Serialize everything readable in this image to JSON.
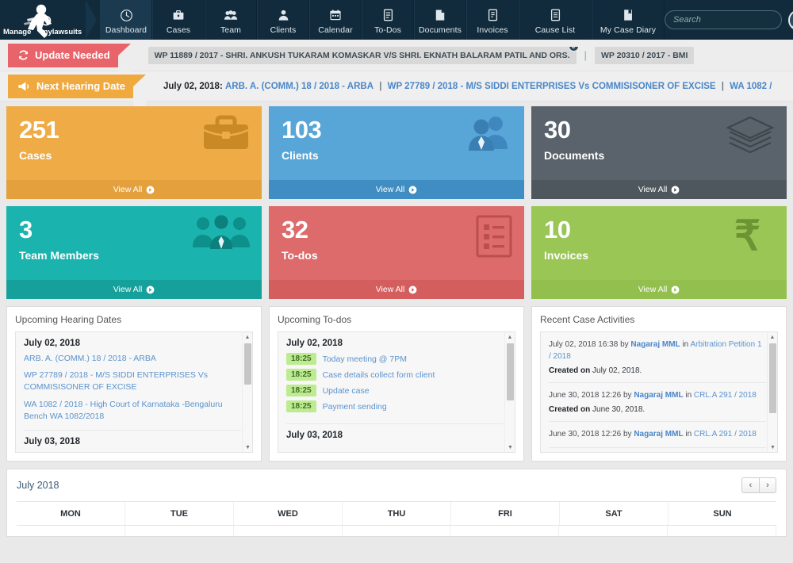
{
  "nav": {
    "logo": {
      "name": "Manage mylawsuits",
      "line1": "Manage",
      "line2": "mylawsuits"
    },
    "items": [
      {
        "label": "Dashboard",
        "icon": "dashboard-icon",
        "active": true
      },
      {
        "label": "Cases",
        "icon": "briefcase-icon",
        "active": false
      },
      {
        "label": "Team",
        "icon": "team-icon",
        "active": false
      },
      {
        "label": "Clients",
        "icon": "client-icon",
        "active": false
      },
      {
        "label": "Calendar",
        "icon": "calendar-icon",
        "active": false
      },
      {
        "label": "To-Dos",
        "icon": "todo-icon",
        "active": false
      },
      {
        "label": "Documents",
        "icon": "document-icon",
        "active": false
      },
      {
        "label": "Invoices",
        "icon": "invoice-icon",
        "active": false
      },
      {
        "label": "Cause List",
        "icon": "causelist-icon",
        "active": false
      },
      {
        "label": "My Case Diary",
        "icon": "diary-icon",
        "active": false
      }
    ],
    "search": {
      "placeholder": "Search",
      "value": "",
      "icon": "search-icon"
    },
    "avatar_icon": "user-avatar",
    "caret": "❯"
  },
  "update_bar": {
    "flag_label": "Update Needed",
    "flag_icon": "refresh-icon",
    "flag_color": "#e8646a",
    "chips": [
      {
        "text": "WP 11889 / 2017 - SHRI. ANKUSH TUKARAM KOMASKAR V/S SHRI. EKNATH BALARAM PATIL AND ORS.",
        "badge": "0"
      },
      {
        "text": "WP 20310 / 2017 - BMI",
        "badge": ""
      }
    ],
    "separator": "|"
  },
  "hearing_bar": {
    "flag_label": "Next Hearing Date",
    "flag_icon": "megaphone-icon",
    "flag_color": "#f0a93f",
    "date": "July 02, 2018:",
    "links": [
      "ARB. A. (COMM.) 18 / 2018 - ARBA",
      "WP 27789 / 2018 - M/S SIDDI ENTERPRISES Vs COMMISISONER OF EXCISE",
      "WA 1082 /"
    ],
    "separator": "|"
  },
  "cards": [
    {
      "count": "251",
      "label": "Cases",
      "icon": "briefcase-icon",
      "view_all": "View All",
      "theme": "c-orange"
    },
    {
      "count": "103",
      "label": "Clients",
      "icon": "clients-icon",
      "view_all": "View All",
      "theme": "c-blue"
    },
    {
      "count": "30",
      "label": "Documents",
      "icon": "stack-icon",
      "view_all": "View All",
      "theme": "c-gray"
    },
    {
      "count": "3",
      "label": "Team Members",
      "icon": "team3-icon",
      "view_all": "View All",
      "theme": "c-teal"
    },
    {
      "count": "32",
      "label": "To-dos",
      "icon": "checklist-icon",
      "view_all": "View All",
      "theme": "c-red"
    },
    {
      "count": "10",
      "label": "Invoices",
      "icon": "rupee-icon",
      "view_all": "View All",
      "theme": "c-green"
    }
  ],
  "hearing_panel": {
    "title": "Upcoming Hearing Dates",
    "groups": [
      {
        "date": "July 02, 2018",
        "items": [
          "ARB. A. (COMM.) 18 / 2018 - ARBA",
          "WP 27789 / 2018 - M/S SIDDI ENTERPRISES Vs COMMISISONER OF EXCISE",
          "WA 1082 / 2018 - High Court of Karnataka -Bengaluru Bench WA 1082/2018"
        ]
      },
      {
        "date": "July 03, 2018",
        "items": []
      }
    ]
  },
  "todo_panel": {
    "title": "Upcoming To-dos",
    "groups": [
      {
        "date": "July 02, 2018",
        "items": [
          {
            "time": "18:25",
            "text": "Today meeting @ 7PM"
          },
          {
            "time": "18:25",
            "text": "Case details collect form client"
          },
          {
            "time": "18:25",
            "text": "Update case"
          },
          {
            "time": "18:25",
            "text": "Payment sending"
          }
        ]
      },
      {
        "date": "July 03, 2018",
        "items": []
      }
    ]
  },
  "activity_panel": {
    "title": "Recent Case Activities",
    "items": [
      {
        "stamp": "July 02, 2018 16:38",
        "by": "by",
        "user": "Nagaraj MML",
        "in": "in",
        "case": "Arbitration Petition 1 / 2018",
        "created_label": "Created on",
        "created_value": "July 02, 2018."
      },
      {
        "stamp": "June 30, 2018 12:26",
        "by": "by",
        "user": "Nagaraj MML",
        "in": "in",
        "case": "CRL.A 291 / 2018",
        "created_label": "Created on",
        "created_value": "June 30, 2018."
      },
      {
        "stamp": "June 30, 2018 12:26",
        "by": "by",
        "user": "Nagaraj MML",
        "in": "in",
        "case": "CRL.A 291 / 2018",
        "created_label": "",
        "created_value": ""
      }
    ]
  },
  "calendar": {
    "title": "July 2018",
    "prev": "‹",
    "next": "›",
    "days": [
      "MON",
      "TUE",
      "WED",
      "THU",
      "FRI",
      "SAT",
      "SUN"
    ]
  }
}
